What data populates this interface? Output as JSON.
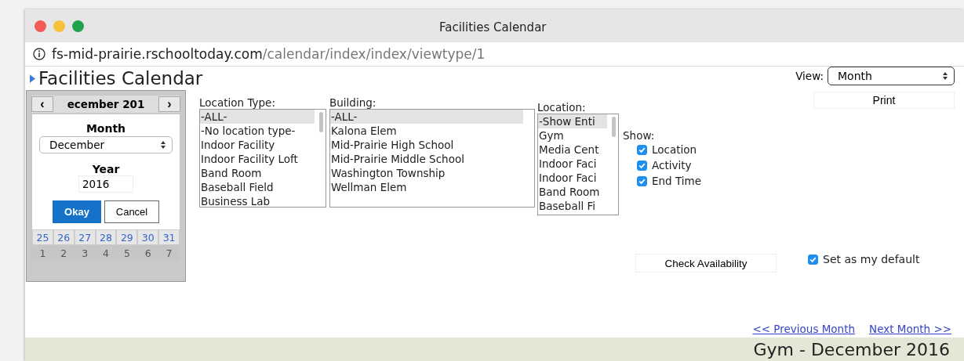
{
  "window": {
    "title": "Facilities Calendar"
  },
  "address_bar": {
    "host": "fs-mid-prairie.rschooltoday.com",
    "path": "/calendar/index/index/viewtype/1"
  },
  "page_title": "Facilities Calendar",
  "date_picker": {
    "prev": "‹",
    "header": "ecember 201",
    "next": "›",
    "month_label": "Month",
    "month_value": "December",
    "year_label": "Year",
    "year_value": "2016",
    "okay": "Okay",
    "cancel": "Cancel",
    "weeks": [
      [
        {
          "day": "25",
          "current": true
        },
        {
          "day": "26",
          "current": true
        },
        {
          "day": "27",
          "current": true
        },
        {
          "day": "28",
          "current": true
        },
        {
          "day": "29",
          "current": true
        },
        {
          "day": "30",
          "current": true
        },
        {
          "day": "31",
          "current": true
        }
      ],
      [
        {
          "day": "1",
          "current": false
        },
        {
          "day": "2",
          "current": false
        },
        {
          "day": "3",
          "current": false
        },
        {
          "day": "4",
          "current": false
        },
        {
          "day": "5",
          "current": false
        },
        {
          "day": "6",
          "current": false
        },
        {
          "day": "7",
          "current": false
        }
      ]
    ]
  },
  "filters": [
    {
      "label": "Location Type:",
      "items": [
        {
          "text": "-ALL-",
          "selected": true
        },
        {
          "text": "-No location type-",
          "selected": false
        },
        {
          "text": "Indoor Facility",
          "selected": false
        },
        {
          "text": "Indoor Facility Loft",
          "selected": false
        },
        {
          "text": "Band Room",
          "selected": false
        },
        {
          "text": "Baseball Field",
          "selected": false
        },
        {
          "text": "Business Lab",
          "selected": false
        }
      ]
    },
    {
      "label": "Building:",
      "items": [
        {
          "text": "-ALL-",
          "selected": true
        },
        {
          "text": "Kalona Elem",
          "selected": false
        },
        {
          "text": "Mid-Prairie High School",
          "selected": false
        },
        {
          "text": "Mid-Prairie Middle School",
          "selected": false
        },
        {
          "text": "Washington Township",
          "selected": false
        },
        {
          "text": "Wellman Elem",
          "selected": false
        }
      ]
    },
    {
      "label": "Location:",
      "items": [
        {
          "text": "-Show Enti",
          "selected": true
        },
        {
          "text": "Gym",
          "selected": false
        },
        {
          "text": "Media Cent",
          "selected": false
        },
        {
          "text": "Indoor Faci",
          "selected": false
        },
        {
          "text": "Indoor Faci",
          "selected": false
        },
        {
          "text": "Band Room",
          "selected": false
        },
        {
          "text": "Baseball Fi",
          "selected": false
        }
      ]
    }
  ],
  "show": {
    "label": "Show:",
    "options": [
      {
        "label": "Location",
        "checked": true
      },
      {
        "label": "Activity",
        "checked": true
      },
      {
        "label": "End Time",
        "checked": true
      }
    ]
  },
  "view": {
    "label": "View:",
    "value": "Month"
  },
  "print_button": "Print",
  "check_availability_button": "Check Availability",
  "set_default": {
    "label": "Set as my default",
    "checked": true
  },
  "nav_links": [
    "<< Previous Month",
    "Next Month >>"
  ],
  "calendar_heading": "Gym - December 2016"
}
